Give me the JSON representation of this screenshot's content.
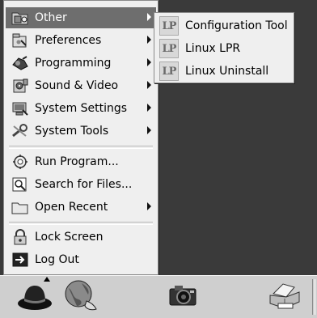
{
  "menu": {
    "items": [
      {
        "label": "Other",
        "icon": "other-folder-icon",
        "has_submenu": true,
        "active": true
      },
      {
        "label": "Preferences",
        "icon": "preferences-icon",
        "has_submenu": true
      },
      {
        "label": "Programming",
        "icon": "programming-icon",
        "has_submenu": true
      },
      {
        "label": "Sound & Video",
        "icon": "sound-video-icon",
        "has_submenu": true
      },
      {
        "label": "System Settings",
        "icon": "system-settings-icon",
        "has_submenu": true
      },
      {
        "label": "System Tools",
        "icon": "system-tools-icon",
        "has_submenu": true
      },
      {
        "label": "Run Program...",
        "icon": "run-program-icon",
        "has_submenu": false
      },
      {
        "label": "Search for Files...",
        "icon": "search-files-icon",
        "has_submenu": false
      },
      {
        "label": "Open Recent",
        "icon": "open-recent-folder-icon",
        "has_submenu": true
      },
      {
        "label": "Lock Screen",
        "icon": "lock-icon",
        "has_submenu": false
      },
      {
        "label": "Log Out",
        "icon": "logout-icon",
        "has_submenu": false
      }
    ]
  },
  "submenu": {
    "items": [
      {
        "label": "Configuration Tool",
        "icon_text": "LP"
      },
      {
        "label": "Linux LPR",
        "icon_text": "LP"
      },
      {
        "label": "Linux Uninstall",
        "icon_text": "LP"
      }
    ]
  },
  "panel": {
    "launchers": [
      "redhat-hat-icon",
      "web-browser-globe-icon",
      "camera-icon",
      "printer-icon"
    ]
  },
  "colors": {
    "menu_bg": "#efefef",
    "highlight": "#6e6e6e",
    "desktop": "#3a3a3a",
    "panel": "#cfcfcf"
  }
}
